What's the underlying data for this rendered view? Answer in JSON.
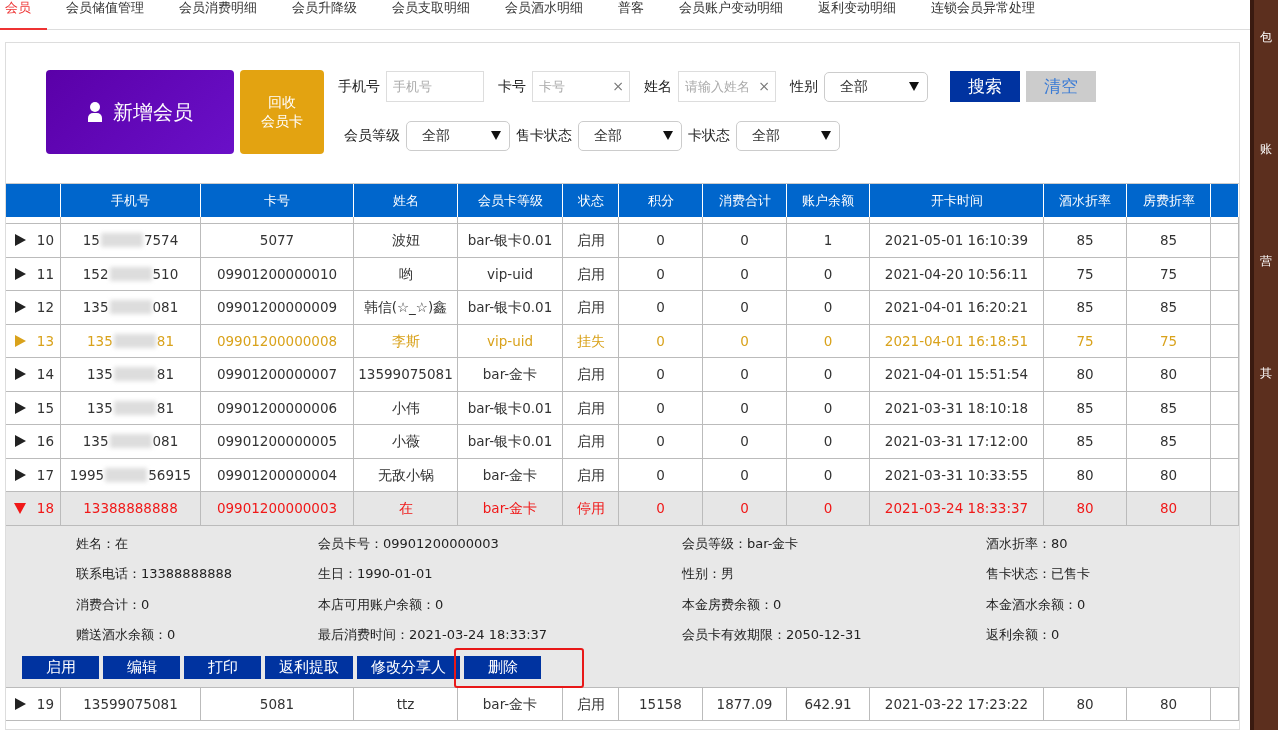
{
  "tabs": [
    {
      "label": "会员",
      "selected": true
    },
    {
      "label": "会员储值管理",
      "selected": false
    },
    {
      "label": "会员消费明细",
      "selected": false
    },
    {
      "label": "会员升降级",
      "selected": false
    },
    {
      "label": "会员支取明细",
      "selected": false
    },
    {
      "label": "会员酒水明细",
      "selected": false
    },
    {
      "label": "普客",
      "selected": false
    },
    {
      "label": "会员账户变动明细",
      "selected": false
    },
    {
      "label": "返利变动明细",
      "selected": false
    },
    {
      "label": "连锁会员异常处理",
      "selected": false
    }
  ],
  "actions": {
    "add_member": "新增会员",
    "recycle_card": [
      "回收",
      "会员卡"
    ]
  },
  "filters": [
    {
      "kind": "input",
      "label": "手机号",
      "placeholder": "手机号"
    },
    {
      "kind": "input",
      "label": "卡号",
      "placeholder": "卡号",
      "clear_icon": "×"
    },
    {
      "kind": "input",
      "label": "姓名",
      "placeholder": "请输入姓名",
      "clear_icon": "×"
    },
    {
      "kind": "select",
      "label": "性别",
      "value": "全部"
    },
    {
      "kind": "select",
      "label": "会员等级",
      "value": "全部"
    },
    {
      "kind": "select",
      "label": "售卡状态",
      "value": "全部"
    },
    {
      "kind": "select",
      "label": "卡状态",
      "value": "全部"
    }
  ],
  "search_button": "搜索",
  "clear_button": "清空",
  "table": {
    "columns": [
      "",
      "手机号",
      "卡号",
      "姓名",
      "会员卡等级",
      "状态",
      "积分",
      "消费合计",
      "账户余额",
      "开卡时间",
      "酒水折率",
      "房费折率"
    ],
    "rows": [
      {
        "kind": "normal",
        "expanded": false,
        "phone_end": "7574",
        "cells": [
          "10",
          "15",
          "5077",
          "波妞",
          "bar-银卡0.01",
          "启用",
          "0",
          "0",
          "1",
          "2021-05-01 16:10:39",
          "85",
          "85"
        ]
      },
      {
        "kind": "normal",
        "expanded": false,
        "phone_end": "510",
        "cells": [
          "11",
          "152",
          "09901200000010",
          "哟",
          "vip-uid",
          "启用",
          "0",
          "0",
          "0",
          "2021-04-20 10:56:11",
          "75",
          "75"
        ]
      },
      {
        "kind": "normal",
        "expanded": false,
        "phone_end": "081",
        "cells": [
          "12",
          "135",
          "09901200000009",
          "韩信(☆_☆)鑫",
          "bar-银卡0.01",
          "启用",
          "0",
          "0",
          "0",
          "2021-04-01 16:20:21",
          "85",
          "85"
        ]
      },
      {
        "kind": "lost",
        "expanded": false,
        "phone_end": "81",
        "cells": [
          "13",
          "135",
          "09901200000008",
          "李斯",
          "vip-uid",
          "挂失",
          "0",
          "0",
          "0",
          "2021-04-01 16:18:51",
          "75",
          "75"
        ]
      },
      {
        "kind": "normal",
        "expanded": false,
        "phone_end": "81",
        "cells": [
          "14",
          "135",
          "09901200000007",
          "13599075081",
          "bar-金卡",
          "启用",
          "0",
          "0",
          "0",
          "2021-04-01 15:51:54",
          "80",
          "80"
        ]
      },
      {
        "kind": "normal",
        "expanded": false,
        "phone_end": "81",
        "cells": [
          "15",
          "135",
          "09901200000006",
          "小伟",
          "bar-银卡0.01",
          "启用",
          "0",
          "0",
          "0",
          "2021-03-31 18:10:18",
          "85",
          "85"
        ]
      },
      {
        "kind": "normal",
        "expanded": false,
        "phone_end": "081",
        "cells": [
          "16",
          "135",
          "09901200000005",
          "小薇",
          "bar-银卡0.01",
          "启用",
          "0",
          "0",
          "0",
          "2021-03-31 17:12:00",
          "85",
          "85"
        ]
      },
      {
        "kind": "normal",
        "expanded": false,
        "phone_end": "56915",
        "cells": [
          "17",
          "1995",
          "09901200000004",
          "无敌小锅",
          "bar-金卡",
          "启用",
          "0",
          "0",
          "0",
          "2021-03-31 10:33:55",
          "80",
          "80"
        ]
      },
      {
        "kind": "stopped",
        "expanded": true,
        "cells": [
          "18",
          "13388888888",
          "09901200000003",
          "在",
          "bar-金卡",
          "停用",
          "0",
          "0",
          "0",
          "2021-03-24 18:33:37",
          "80",
          "80"
        ]
      },
      {
        "kind": "normal",
        "expanded": false,
        "cells": [
          "19",
          "13599075081",
          "5081",
          "ttz",
          "bar-金卡",
          "启用",
          "15158",
          "1877.09",
          "642.91",
          "2021-03-22 17:23:22",
          "80",
          "80"
        ]
      }
    ]
  },
  "detail": {
    "fields": [
      {
        "label": "姓名：",
        "value": "在"
      },
      {
        "label": "会员卡号：",
        "value": "09901200000003"
      },
      {
        "label": "会员等级：",
        "value": "bar-金卡"
      },
      {
        "label": "酒水折率：",
        "value": "80"
      },
      {
        "label": "联系电话：",
        "value": "13388888888"
      },
      {
        "label": "生日：",
        "value": "1990-01-01"
      },
      {
        "label": "性别：",
        "value": "男"
      },
      {
        "label": "售卡状态：",
        "value": "已售卡"
      },
      {
        "label": "消费合计：",
        "value": "0"
      },
      {
        "label": "本店可用账户余额：",
        "value": "0"
      },
      {
        "label": "本金房费余额：",
        "value": "0"
      },
      {
        "label": "本金酒水余额：",
        "value": "0"
      },
      {
        "label": "赠送酒水余额：",
        "value": "0"
      },
      {
        "label": "最后消费时间：",
        "value": "2021-03-24 18:33:37"
      },
      {
        "label": "会员卡有效期限：",
        "value": "2050-12-31"
      },
      {
        "label": "返利余额：",
        "value": "0"
      }
    ],
    "buttons": [
      {
        "label": "启用",
        "highlighted": false
      },
      {
        "label": "编辑",
        "highlighted": false
      },
      {
        "label": "打印",
        "highlighted": false
      },
      {
        "label": "返利提取",
        "highlighted": false
      },
      {
        "label": "修改分享人",
        "highlighted": false
      },
      {
        "label": "删除",
        "highlighted": true
      }
    ]
  },
  "side_strip": [
    "包",
    "账",
    "营",
    "其"
  ]
}
